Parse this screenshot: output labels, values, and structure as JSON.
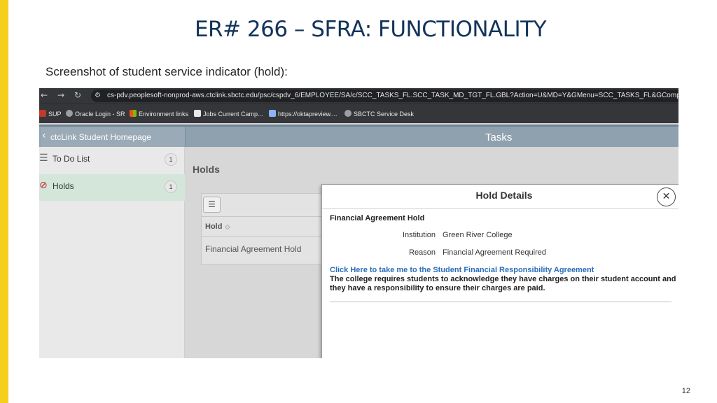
{
  "slide": {
    "title": "ER# 266 – SFRA: FUNCTIONALITY",
    "subtitle": "Screenshot of student service indicator (hold):",
    "page_number": "12",
    "accent_color": "#f5cf1c",
    "title_color": "#13345b"
  },
  "browser": {
    "url": "cs-pdv.peoplesoft-nonprod-aws.ctclink.sbctc.edu/psc/cspdv_6/EMPLOYEE/SA/c/SCC_TASKS_FL.SCC_TASK_MD_TGT_FL.GBL?Action=U&MD=Y&GMenu=SCC_TASKS_FL&GComp=SCC_TASKS_SI",
    "bookmarks": [
      "SUP",
      "Oracle Login - SR",
      "Environment links",
      "Jobs Current Camp...",
      "https://oktapreview....",
      "SBCTC Service Desk"
    ]
  },
  "app": {
    "back_label": "ctcLink Student Homepage",
    "header_title": "Tasks",
    "sidebar": [
      {
        "label": "To Do List",
        "count": "1",
        "icon": "list-icon"
      },
      {
        "label": "Holds",
        "count": "1",
        "icon": "no-entry-icon"
      }
    ],
    "main_title": "Holds",
    "grid": {
      "column": "Hold",
      "rows": [
        "Financial Agreement Hold"
      ]
    }
  },
  "modal": {
    "title": "Hold Details",
    "hold_name": "Financial Agreement Hold",
    "fields": [
      {
        "label": "Institution",
        "value": "Green River College"
      },
      {
        "label": "Reason",
        "value": "Financial Agreement Required"
      }
    ],
    "link": "Click Here to take me to the Student Financial Responsibility Agreement",
    "text": "The college requires students to acknowledge they have charges on their student account and they have a responsibility to ensure their charges are paid."
  }
}
